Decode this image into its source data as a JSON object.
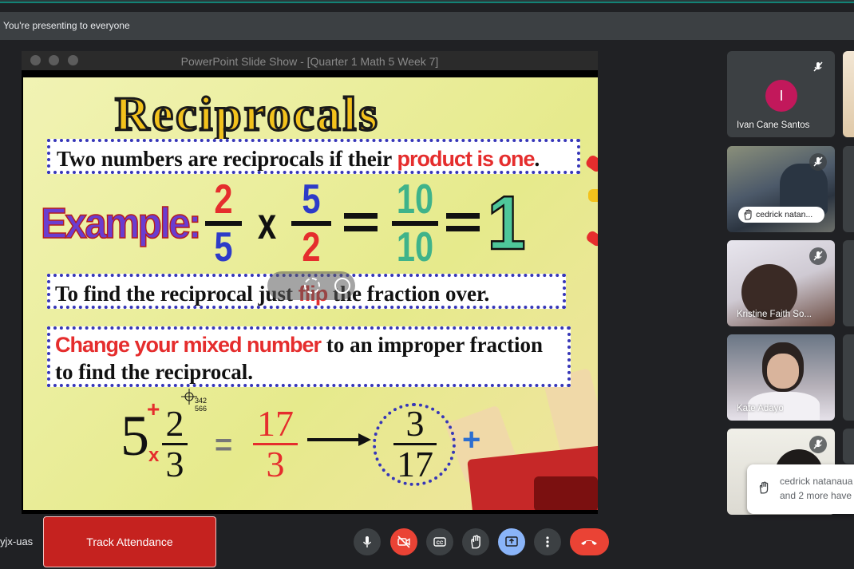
{
  "banner": {
    "presenting_text": "You're presenting to everyone"
  },
  "presentation": {
    "window_title": "PowerPoint Slide Show - [Quarter 1 Math 5 Week 7]",
    "slide": {
      "heading": "Reciprocals",
      "definition_prefix": "Two numbers are reciprocals if their ",
      "definition_highlight": "product is one",
      "definition_suffix": ".",
      "example_label": "Example:",
      "example": {
        "frac1_num": "2",
        "frac1_den": "5",
        "times": "x",
        "frac2_num": "5",
        "frac2_den": "2",
        "result_num": "10",
        "result_den": "10",
        "final": "1"
      },
      "flip_prefix": "To find the reciprocal just ",
      "flip_highlight": "flip",
      "flip_suffix": " the fraction over.",
      "mixed_highlight": "Change your mixed number",
      "mixed_suffix": " to an improper fraction",
      "mixed_line2": "to find the reciprocal.",
      "mixed_example": {
        "whole": "5",
        "plus": "+",
        "mult": "x",
        "num": "2",
        "den": "3",
        "equals": "=",
        "improper_num": "17",
        "improper_den": "3",
        "recip_num": "3",
        "recip_den": "17"
      },
      "cursor_readout_x": "342",
      "cursor_readout_y": "566"
    }
  },
  "participants": [
    {
      "name": "Ivan Cane Santos",
      "avatar_letter": "I",
      "avatar_color": "#c2185b",
      "muted": true
    },
    {
      "name": "cedrick natan...",
      "hand_raised": true,
      "muted": true
    },
    {
      "name": "Kristine Faith So...",
      "muted": true
    },
    {
      "name": "Kate Adayo",
      "muted": false
    },
    {
      "name": "",
      "muted": true
    }
  ],
  "hand_toast": {
    "line1": "cedrick natanaua",
    "line2": "and 2 more have"
  },
  "bottom_bar": {
    "meeting_code": "yjx-uas",
    "track_attendance": "Track Attendance",
    "controls": [
      "microphone-icon",
      "camera-off-icon",
      "captions-icon",
      "raise-hand-icon",
      "present-icon",
      "more-options-icon",
      "end-call-icon"
    ]
  },
  "colors": {
    "end_call": "#ea4335",
    "present_active": "#8ab4f8",
    "track_button": "#c5221f",
    "slide_red": "#e52d2d",
    "slide_blue": "#2d3bc8",
    "slide_teal": "#3fb38a"
  }
}
